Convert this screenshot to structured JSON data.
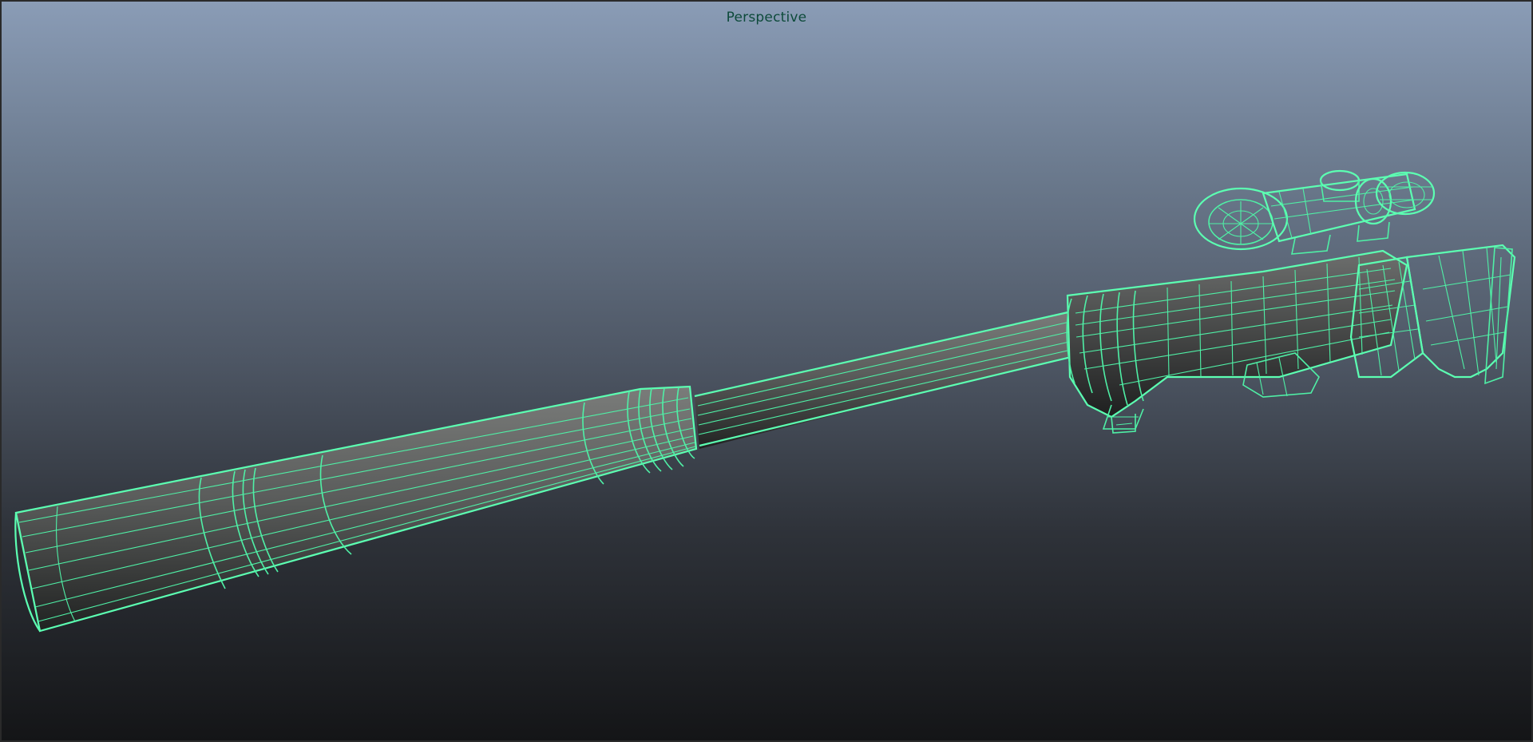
{
  "viewport": {
    "label": "Perspective",
    "wireframe_color": "#4ff0a6",
    "background_top": "#8a9cb6",
    "background_bottom": "#141517"
  },
  "scene": {
    "object": "sniper-rifle-wireframe-mesh"
  }
}
